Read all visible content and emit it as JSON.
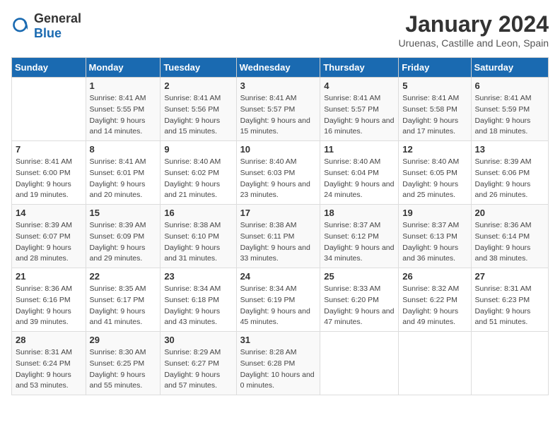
{
  "logo": {
    "general": "General",
    "blue": "Blue"
  },
  "title": "January 2024",
  "subtitle": "Uruenas, Castille and Leon, Spain",
  "days_header": [
    "Sunday",
    "Monday",
    "Tuesday",
    "Wednesday",
    "Thursday",
    "Friday",
    "Saturday"
  ],
  "weeks": [
    [
      {
        "num": "",
        "sunrise": "",
        "sunset": "",
        "daylight": ""
      },
      {
        "num": "1",
        "sunrise": "Sunrise: 8:41 AM",
        "sunset": "Sunset: 5:55 PM",
        "daylight": "Daylight: 9 hours and 14 minutes."
      },
      {
        "num": "2",
        "sunrise": "Sunrise: 8:41 AM",
        "sunset": "Sunset: 5:56 PM",
        "daylight": "Daylight: 9 hours and 15 minutes."
      },
      {
        "num": "3",
        "sunrise": "Sunrise: 8:41 AM",
        "sunset": "Sunset: 5:57 PM",
        "daylight": "Daylight: 9 hours and 15 minutes."
      },
      {
        "num": "4",
        "sunrise": "Sunrise: 8:41 AM",
        "sunset": "Sunset: 5:57 PM",
        "daylight": "Daylight: 9 hours and 16 minutes."
      },
      {
        "num": "5",
        "sunrise": "Sunrise: 8:41 AM",
        "sunset": "Sunset: 5:58 PM",
        "daylight": "Daylight: 9 hours and 17 minutes."
      },
      {
        "num": "6",
        "sunrise": "Sunrise: 8:41 AM",
        "sunset": "Sunset: 5:59 PM",
        "daylight": "Daylight: 9 hours and 18 minutes."
      }
    ],
    [
      {
        "num": "7",
        "sunrise": "Sunrise: 8:41 AM",
        "sunset": "Sunset: 6:00 PM",
        "daylight": "Daylight: 9 hours and 19 minutes."
      },
      {
        "num": "8",
        "sunrise": "Sunrise: 8:41 AM",
        "sunset": "Sunset: 6:01 PM",
        "daylight": "Daylight: 9 hours and 20 minutes."
      },
      {
        "num": "9",
        "sunrise": "Sunrise: 8:40 AM",
        "sunset": "Sunset: 6:02 PM",
        "daylight": "Daylight: 9 hours and 21 minutes."
      },
      {
        "num": "10",
        "sunrise": "Sunrise: 8:40 AM",
        "sunset": "Sunset: 6:03 PM",
        "daylight": "Daylight: 9 hours and 23 minutes."
      },
      {
        "num": "11",
        "sunrise": "Sunrise: 8:40 AM",
        "sunset": "Sunset: 6:04 PM",
        "daylight": "Daylight: 9 hours and 24 minutes."
      },
      {
        "num": "12",
        "sunrise": "Sunrise: 8:40 AM",
        "sunset": "Sunset: 6:05 PM",
        "daylight": "Daylight: 9 hours and 25 minutes."
      },
      {
        "num": "13",
        "sunrise": "Sunrise: 8:39 AM",
        "sunset": "Sunset: 6:06 PM",
        "daylight": "Daylight: 9 hours and 26 minutes."
      }
    ],
    [
      {
        "num": "14",
        "sunrise": "Sunrise: 8:39 AM",
        "sunset": "Sunset: 6:07 PM",
        "daylight": "Daylight: 9 hours and 28 minutes."
      },
      {
        "num": "15",
        "sunrise": "Sunrise: 8:39 AM",
        "sunset": "Sunset: 6:09 PM",
        "daylight": "Daylight: 9 hours and 29 minutes."
      },
      {
        "num": "16",
        "sunrise": "Sunrise: 8:38 AM",
        "sunset": "Sunset: 6:10 PM",
        "daylight": "Daylight: 9 hours and 31 minutes."
      },
      {
        "num": "17",
        "sunrise": "Sunrise: 8:38 AM",
        "sunset": "Sunset: 6:11 PM",
        "daylight": "Daylight: 9 hours and 33 minutes."
      },
      {
        "num": "18",
        "sunrise": "Sunrise: 8:37 AM",
        "sunset": "Sunset: 6:12 PM",
        "daylight": "Daylight: 9 hours and 34 minutes."
      },
      {
        "num": "19",
        "sunrise": "Sunrise: 8:37 AM",
        "sunset": "Sunset: 6:13 PM",
        "daylight": "Daylight: 9 hours and 36 minutes."
      },
      {
        "num": "20",
        "sunrise": "Sunrise: 8:36 AM",
        "sunset": "Sunset: 6:14 PM",
        "daylight": "Daylight: 9 hours and 38 minutes."
      }
    ],
    [
      {
        "num": "21",
        "sunrise": "Sunrise: 8:36 AM",
        "sunset": "Sunset: 6:16 PM",
        "daylight": "Daylight: 9 hours and 39 minutes."
      },
      {
        "num": "22",
        "sunrise": "Sunrise: 8:35 AM",
        "sunset": "Sunset: 6:17 PM",
        "daylight": "Daylight: 9 hours and 41 minutes."
      },
      {
        "num": "23",
        "sunrise": "Sunrise: 8:34 AM",
        "sunset": "Sunset: 6:18 PM",
        "daylight": "Daylight: 9 hours and 43 minutes."
      },
      {
        "num": "24",
        "sunrise": "Sunrise: 8:34 AM",
        "sunset": "Sunset: 6:19 PM",
        "daylight": "Daylight: 9 hours and 45 minutes."
      },
      {
        "num": "25",
        "sunrise": "Sunrise: 8:33 AM",
        "sunset": "Sunset: 6:20 PM",
        "daylight": "Daylight: 9 hours and 47 minutes."
      },
      {
        "num": "26",
        "sunrise": "Sunrise: 8:32 AM",
        "sunset": "Sunset: 6:22 PM",
        "daylight": "Daylight: 9 hours and 49 minutes."
      },
      {
        "num": "27",
        "sunrise": "Sunrise: 8:31 AM",
        "sunset": "Sunset: 6:23 PM",
        "daylight": "Daylight: 9 hours and 51 minutes."
      }
    ],
    [
      {
        "num": "28",
        "sunrise": "Sunrise: 8:31 AM",
        "sunset": "Sunset: 6:24 PM",
        "daylight": "Daylight: 9 hours and 53 minutes."
      },
      {
        "num": "29",
        "sunrise": "Sunrise: 8:30 AM",
        "sunset": "Sunset: 6:25 PM",
        "daylight": "Daylight: 9 hours and 55 minutes."
      },
      {
        "num": "30",
        "sunrise": "Sunrise: 8:29 AM",
        "sunset": "Sunset: 6:27 PM",
        "daylight": "Daylight: 9 hours and 57 minutes."
      },
      {
        "num": "31",
        "sunrise": "Sunrise: 8:28 AM",
        "sunset": "Sunset: 6:28 PM",
        "daylight": "Daylight: 10 hours and 0 minutes."
      },
      {
        "num": "",
        "sunrise": "",
        "sunset": "",
        "daylight": ""
      },
      {
        "num": "",
        "sunrise": "",
        "sunset": "",
        "daylight": ""
      },
      {
        "num": "",
        "sunrise": "",
        "sunset": "",
        "daylight": ""
      }
    ]
  ]
}
